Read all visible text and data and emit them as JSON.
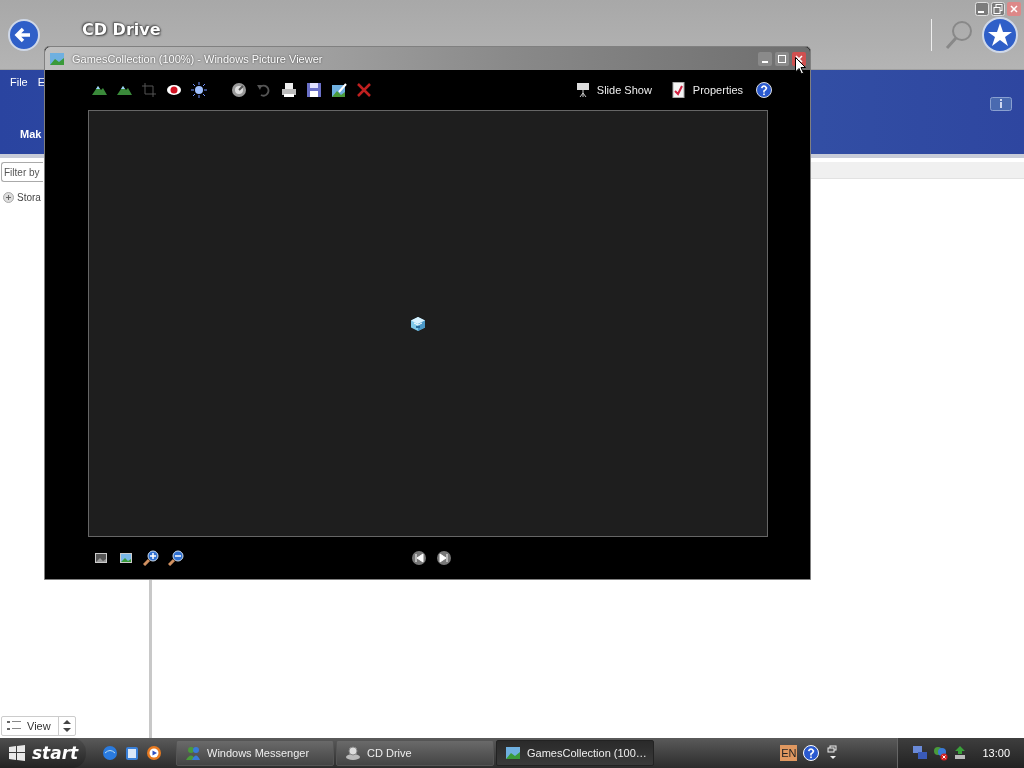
{
  "explorer": {
    "title": "CD Drive",
    "menu": [
      "File",
      "E"
    ],
    "task_heading": "Mak",
    "filter": {
      "placeholder": "Filter by"
    },
    "tree": [
      {
        "label": "Stora",
        "expanded": false
      }
    ],
    "view_button": "View"
  },
  "viewer": {
    "title": "GamesCollection (100%) - Windows Picture Viewer",
    "toolbar_right": [
      "Slide Show",
      "Properties"
    ]
  },
  "taskbar": {
    "start": "start",
    "tasks": [
      {
        "label": "Windows Messenger",
        "selected": false
      },
      {
        "label": "CD Drive",
        "selected": false
      },
      {
        "label": "GamesCollection (100…",
        "selected": true
      }
    ],
    "language": "EN",
    "clock": "13:00"
  }
}
